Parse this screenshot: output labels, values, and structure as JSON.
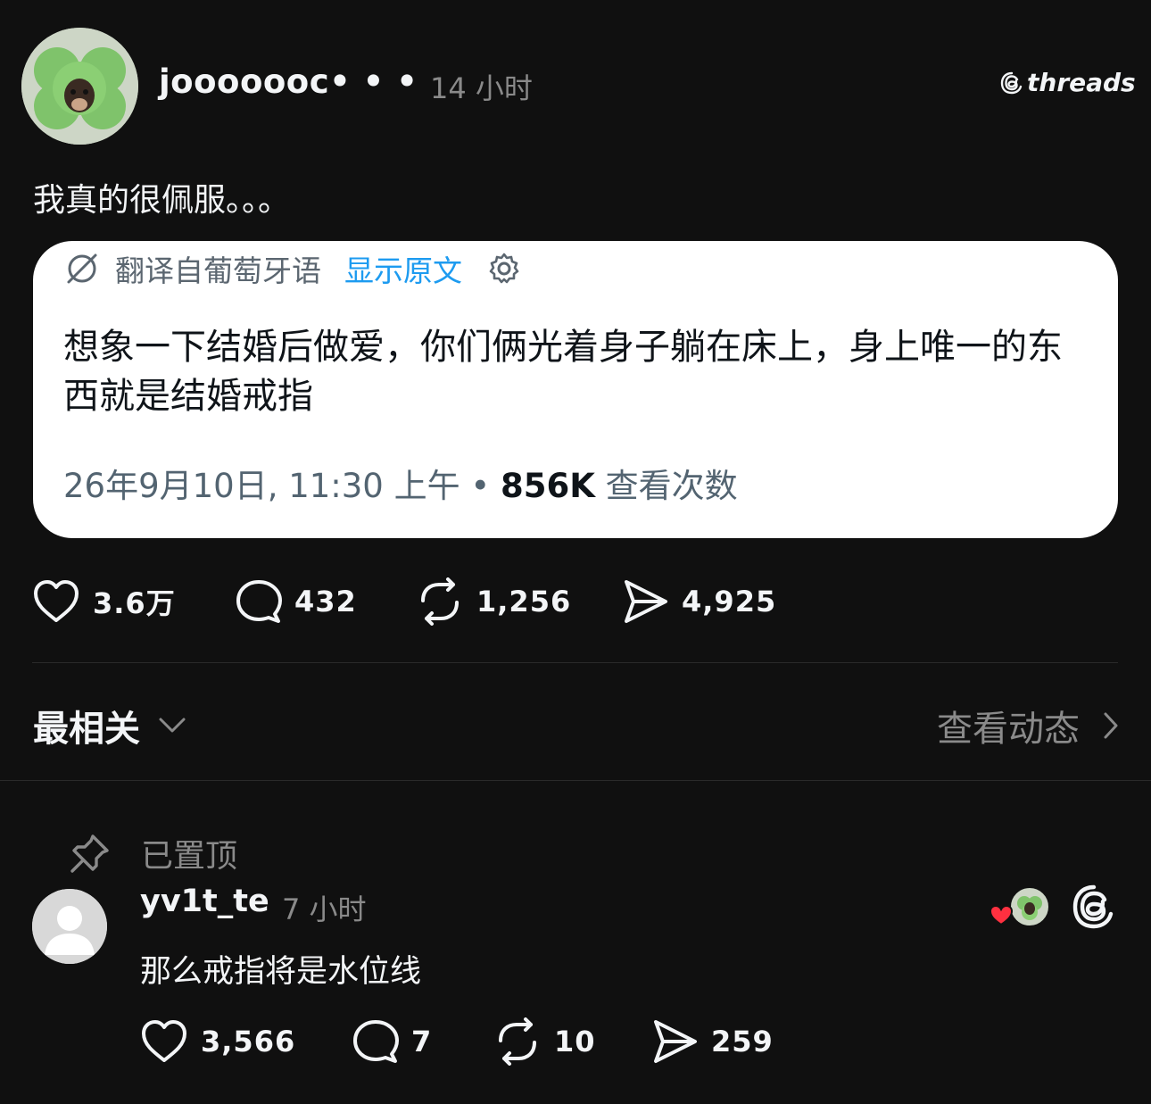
{
  "post": {
    "username": "jooooooc• • •",
    "time": "14 小时",
    "brand": "threads",
    "text": "我真的很佩服。。。",
    "card": {
      "translate_label": "翻译自葡萄牙语",
      "show_original": "显示原文",
      "text": "想象一下结婚后做爱，你们俩光着身子躺在床上，身上唯一的东西就是结婚戒指",
      "date": "26年9月10日, 11:30 上午 • ",
      "views_count": "856K",
      "views_label": " 查看次数"
    },
    "likes": "3.6万",
    "comments": "432",
    "reposts": "1,256",
    "shares": "4,925"
  },
  "feed": {
    "sort_label": "最相关",
    "activity_label": "查看动态"
  },
  "reply": {
    "pinned_label": "已置顶",
    "username": "yv1t_te",
    "time": "7 小时",
    "text": "那么戒指将是水位线",
    "likes": "3,566",
    "comments": "7",
    "reposts": "10",
    "shares": "259"
  },
  "colors": {
    "background": "#101010",
    "text": "#f3f5f7",
    "muted": "#8a8a8a",
    "link": "#1d9bf0",
    "heart": "#ff3040"
  },
  "icons": [
    "heart-icon",
    "comment-icon",
    "repost-icon",
    "share-icon",
    "chevron-down-icon",
    "chevron-right-icon",
    "pin-icon",
    "gear-icon",
    "translate-icon",
    "threads-logo-icon"
  ]
}
